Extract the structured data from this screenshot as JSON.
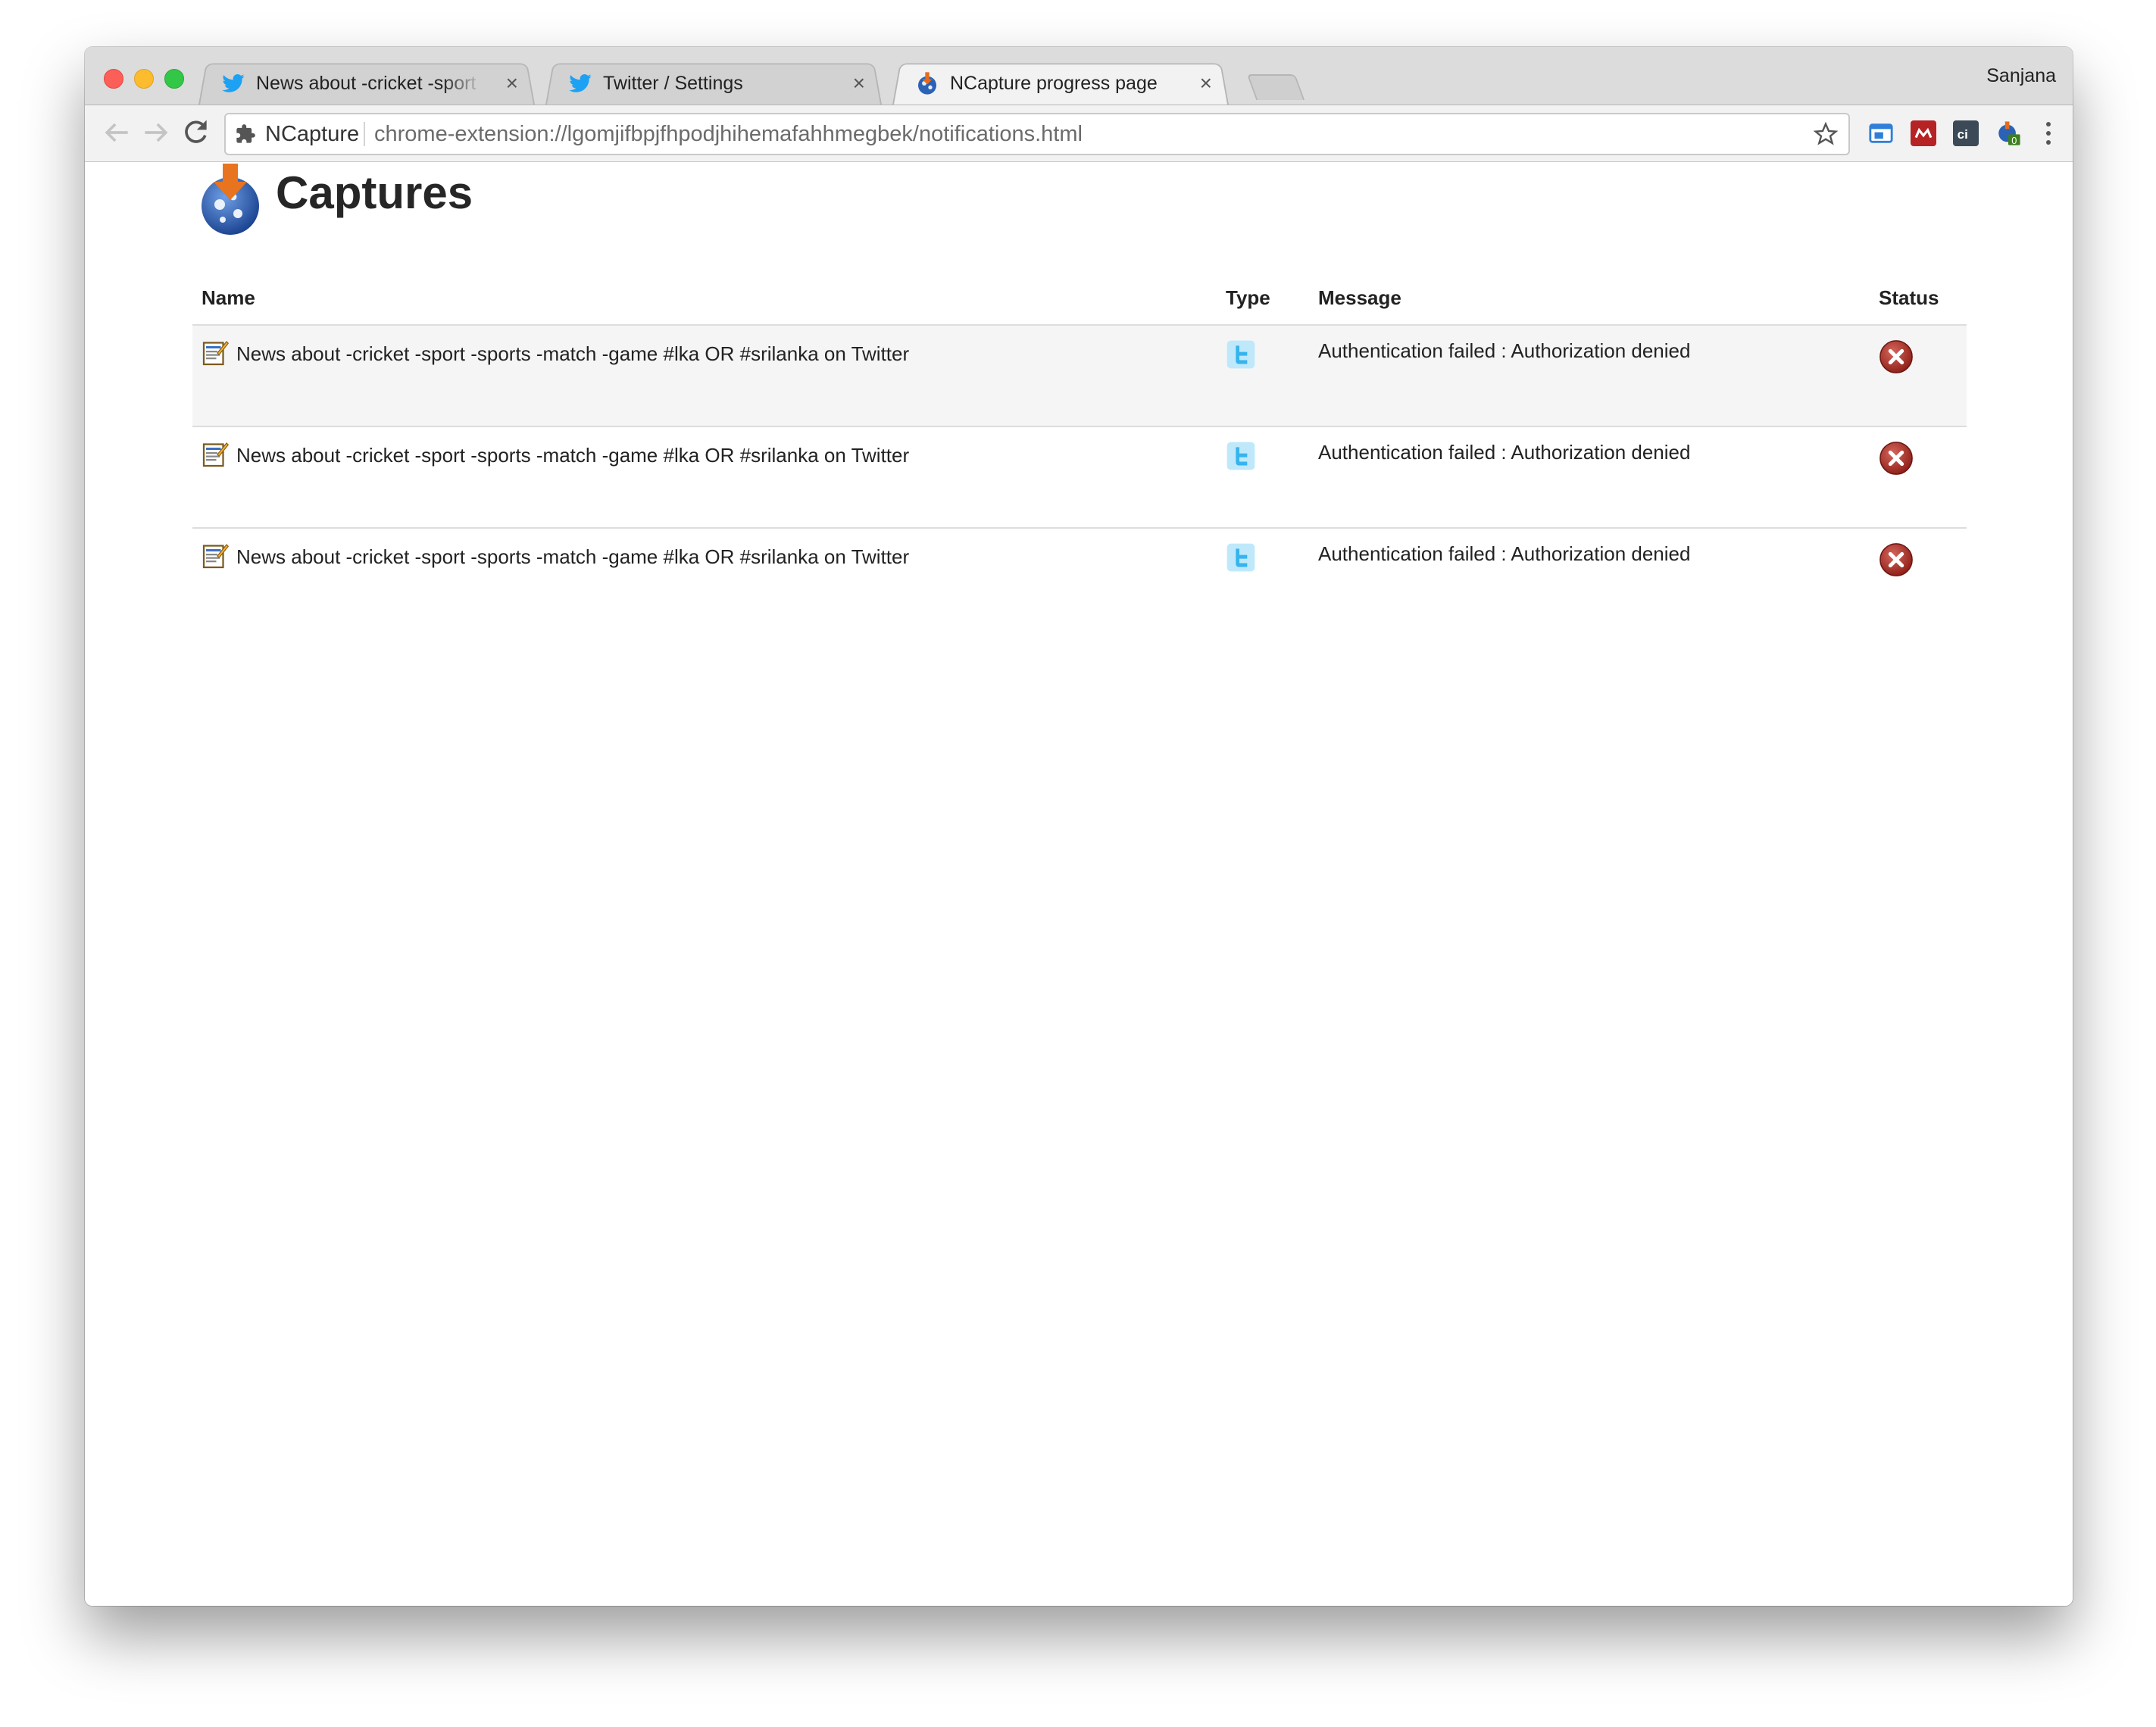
{
  "browser": {
    "tabs": [
      {
        "label": "News about -cricket -sport -sports -match -game #lka OR #srilanka on Twitter",
        "icon": "twitter-bird-icon",
        "active": false
      },
      {
        "label": "Twitter / Settings",
        "icon": "twitter-bird-icon",
        "active": false
      },
      {
        "label": "NCapture progress page",
        "icon": "ncapture-globe-icon",
        "active": true
      }
    ],
    "profile_name": "Sanjana",
    "omnibox": {
      "chip_label": "NCapture",
      "url": "chrome-extension://lgomjifbpjfhpodjhihemafahhmegbek/notifications.html"
    },
    "extensions": [
      {
        "name": "window-extension-icon",
        "color": "#2f7fd8"
      },
      {
        "name": "mendeley-extension-icon",
        "color": "#b52325"
      },
      {
        "name": "ci-extension-icon",
        "color": "#3c4a57"
      },
      {
        "name": "ncapture-extension-icon",
        "color": "#3e7f1f",
        "badge": "0"
      }
    ]
  },
  "page": {
    "title": "Captures",
    "columns": {
      "name": "Name",
      "type": "Type",
      "message": "Message",
      "status": "Status"
    },
    "rows": [
      {
        "name": "News about -cricket -sport -sports -match -game #lka OR #srilanka on Twitter",
        "type": "twitter-icon",
        "message": "Authentication failed : Authorization denied",
        "status": "error-icon"
      },
      {
        "name": "News about -cricket -sport -sports -match -game #lka OR #srilanka on Twitter",
        "type": "twitter-icon",
        "message": "Authentication failed : Authorization denied",
        "status": "error-icon"
      },
      {
        "name": "News about -cricket -sport -sports -match -game #lka OR #srilanka on Twitter",
        "type": "twitter-icon",
        "message": "Authentication failed : Authorization denied",
        "status": "error-icon"
      }
    ]
  }
}
